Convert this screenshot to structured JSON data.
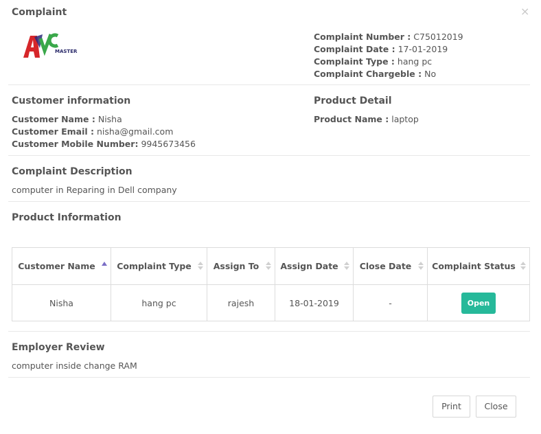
{
  "modal": {
    "title": "Complaint",
    "close_symbol": "×"
  },
  "logo": {
    "text": "MASTER"
  },
  "complaint_meta": {
    "number_label": "Complaint Number :",
    "number_value": "C75012019",
    "date_label": "Complaint Date :",
    "date_value": "17-01-2019",
    "type_label": "Complaint Type :",
    "type_value": "hang pc",
    "chargeable_label": "Complaint Chargeble :",
    "chargeable_value": "No"
  },
  "customer": {
    "heading": "Customer information",
    "name_label": "Customer Name :",
    "name_value": "Nisha",
    "email_label": "Customer Email :",
    "email_value": "nisha@gmail.com",
    "mobile_label": "Customer Mobile Number:",
    "mobile_value": "9945673456"
  },
  "product_detail": {
    "heading": "Product Detail",
    "name_label": "Product Name :",
    "name_value": "laptop"
  },
  "description": {
    "heading": "Complaint Description",
    "text": "computer in Reparing in Dell company"
  },
  "product_info": {
    "heading": "Product Information",
    "columns": [
      "Customer Name",
      "Complaint Type",
      "Assign To",
      "Assign Date",
      "Close Date",
      "Complaint Status"
    ],
    "rows": [
      {
        "customer_name": "Nisha",
        "complaint_type": "hang pc",
        "assign_to": "rajesh",
        "assign_date": "18-01-2019",
        "close_date": "-",
        "status": "Open"
      }
    ]
  },
  "employer_review": {
    "heading": "Employer Review",
    "text": "computer inside change RAM"
  },
  "footer": {
    "print_label": "Print",
    "close_label": "Close"
  },
  "colors": {
    "status_open": "#26b99a",
    "sort_active": "#7b6ec6",
    "sort_inactive": "#d0d0d0"
  }
}
